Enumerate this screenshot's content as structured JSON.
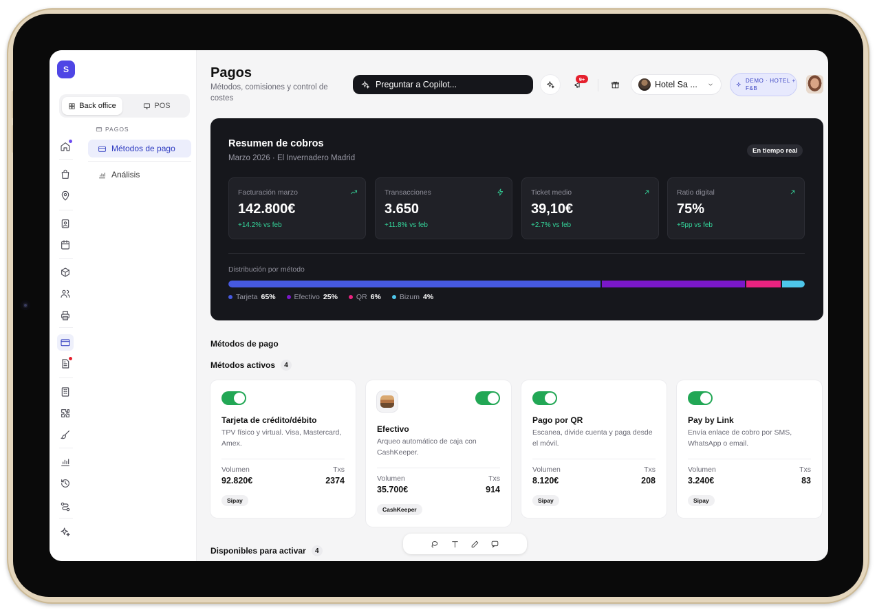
{
  "app": {
    "logo_letter": "S"
  },
  "sidebar": {
    "segments": [
      {
        "label": "Back office",
        "icon": "grid-icon",
        "active": true
      },
      {
        "label": "POS",
        "icon": "monitor-icon",
        "active": false
      }
    ],
    "section_label": "PAGOS",
    "items": [
      {
        "label": "Métodos de pago",
        "icon": "credit-card-icon",
        "active": true
      },
      {
        "label": "Análisis",
        "icon": "bar-chart-icon",
        "active": false
      }
    ]
  },
  "rail_icons": [
    "home-icon",
    "shopping-bag-icon",
    "map-pin-icon",
    "badge-icon",
    "calendar-icon",
    "package-icon",
    "users-icon",
    "printer-icon",
    "credit-card-icon",
    "file-text-icon",
    "building-icon",
    "puzzle-icon",
    "brush-icon",
    "bar-chart-icon",
    "history-icon",
    "route-icon",
    "sparkles-icon"
  ],
  "header": {
    "title": "Pagos",
    "subtitle": "Métodos, comisiones y control de costes",
    "copilot_label": "Preguntar a Copilot...",
    "notification_badge": "9+",
    "hotel_name": "Hotel Sa ...",
    "demo_badge": "DEMO · HOTEL + F&B"
  },
  "summary": {
    "title": "Resumen de cobros",
    "subtitle": "Marzo 2026 · El Invernadero Madrid",
    "realtime_label": "En tiempo real",
    "kpis": [
      {
        "label": "Facturación marzo",
        "value": "142.800€",
        "change": "+14.2% vs feb",
        "icon": "trending-up-icon"
      },
      {
        "label": "Transacciones",
        "value": "3.650",
        "change": "+11.8% vs feb",
        "icon": "zap-icon"
      },
      {
        "label": "Ticket medio",
        "value": "39,10€",
        "change": "+2.7% vs feb",
        "icon": "arrow-up-right-icon"
      },
      {
        "label": "Ratio digital",
        "value": "75%",
        "change": "+5pp vs feb",
        "icon": "arrow-up-right-icon"
      }
    ],
    "distribution_label": "Distribución por método",
    "distribution": [
      {
        "name": "Tarjeta",
        "pct_label": "65%",
        "share": 65,
        "color": "#4659e0"
      },
      {
        "name": "Efectivo",
        "pct_label": "25%",
        "share": 25,
        "color": "#7a18c9"
      },
      {
        "name": "QR",
        "pct_label": "6%",
        "share": 6,
        "color": "#e8237f"
      },
      {
        "name": "Bizum",
        "pct_label": "4%",
        "share": 4,
        "color": "#4ec6ea"
      }
    ]
  },
  "methods": {
    "section_title": "Métodos de pago",
    "active_title": "Métodos activos",
    "active_count": "4",
    "cards": [
      {
        "name": "Tarjeta de crédito/débito",
        "desc": "TPV físico y virtual. Visa, Mastercard, Amex.",
        "volume_label": "Volumen",
        "txs_label": "Txs",
        "volume": "92.820€",
        "txs": "2374",
        "provider": "Sipay",
        "enabled": true
      },
      {
        "name": "Efectivo",
        "desc": "Arqueo automático de caja con CashKeeper.",
        "volume_label": "Volumen",
        "txs_label": "Txs",
        "volume": "35.700€",
        "txs": "914",
        "provider": "CashKeeper",
        "enabled": true
      },
      {
        "name": "Pago por QR",
        "desc": "Escanea, divide cuenta y paga desde el móvil.",
        "volume_label": "Volumen",
        "txs_label": "Txs",
        "volume": "8.120€",
        "txs": "208",
        "provider": "Sipay",
        "enabled": true
      },
      {
        "name": "Pay by Link",
        "desc": "Envía enlace de cobro por SMS, WhatsApp o email.",
        "volume_label": "Volumen",
        "txs_label": "Txs",
        "volume": "3.240€",
        "txs": "83",
        "provider": "Sipay",
        "enabled": true
      }
    ],
    "available_title": "Disponibles para activar",
    "available_count": "4"
  },
  "toolbar_icons": [
    "lasso-icon",
    "text-icon",
    "pencil-icon",
    "comment-icon"
  ]
}
